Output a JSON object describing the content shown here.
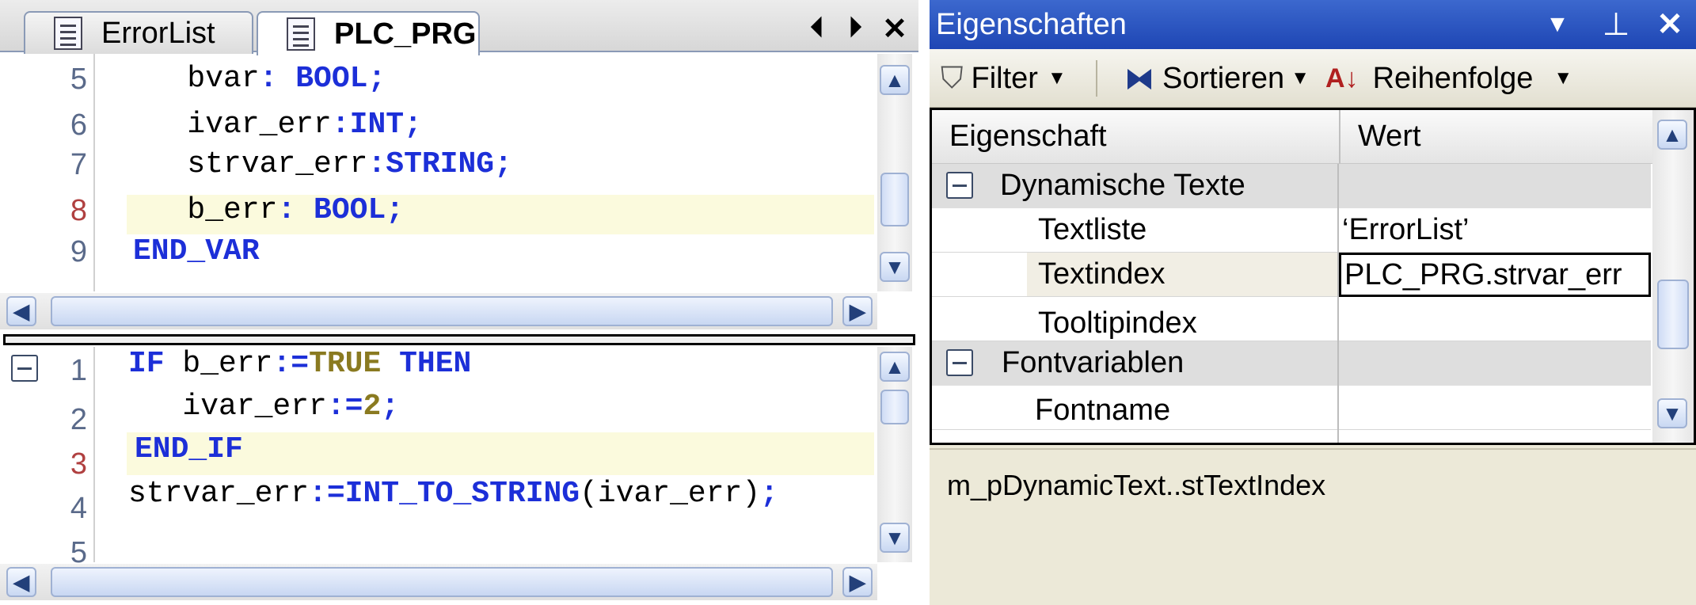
{
  "editor": {
    "tabs": [
      {
        "label": "ErrorList",
        "active": false
      },
      {
        "label": "PLC_PRG",
        "active": true
      }
    ],
    "tab_controls": {
      "prev": "⏴",
      "next": "⏵",
      "close": "✕"
    },
    "declaration_lines": [
      {
        "num": "5",
        "indent": "   ",
        "tokens": [
          {
            "t": "bvar",
            "c": "id"
          },
          {
            "t": ": BOOL;",
            "c": "kw"
          }
        ]
      },
      {
        "num": "6",
        "indent": "   ",
        "tokens": [
          {
            "t": "ivar_err",
            "c": "id"
          },
          {
            "t": ":INT;",
            "c": "kw"
          }
        ]
      },
      {
        "num": "7",
        "indent": "   ",
        "tokens": [
          {
            "t": "strvar_err",
            "c": "id"
          },
          {
            "t": ":STRING;",
            "c": "kw"
          }
        ]
      },
      {
        "num": "8",
        "indent": "   ",
        "tokens": [
          {
            "t": "b_err",
            "c": "id"
          },
          {
            "t": ": BOOL;",
            "c": "kw"
          }
        ]
      },
      {
        "num": "9",
        "indent": "",
        "tokens": [
          {
            "t": "END_VAR",
            "c": "kw"
          }
        ]
      }
    ],
    "implementation_lines": [
      {
        "num": "1",
        "tokens": [
          {
            "t": "IF ",
            "c": "kw"
          },
          {
            "t": "b_err",
            "c": "id"
          },
          {
            "t": ":=",
            "c": "kw"
          },
          {
            "t": "TRUE",
            "c": "lit"
          },
          {
            "t": " THEN",
            "c": "kw"
          }
        ]
      },
      {
        "num": "2",
        "tokens": [
          {
            "t": "   ivar_err",
            "c": "id"
          },
          {
            "t": ":=",
            "c": "kw"
          },
          {
            "t": "2",
            "c": "lit"
          },
          {
            "t": ";",
            "c": "kw"
          }
        ]
      },
      {
        "num": "3",
        "tokens": [
          {
            "t": "END_IF",
            "c": "kw"
          }
        ]
      },
      {
        "num": "4",
        "tokens": [
          {
            "t": "strvar_err",
            "c": "id"
          },
          {
            "t": ":=INT_TO_STRING",
            "c": "kw"
          },
          {
            "t": "(ivar_err)",
            "c": "id"
          },
          {
            "t": ";",
            "c": "kw"
          }
        ]
      },
      {
        "num": "5",
        "tokens": []
      }
    ]
  },
  "properties": {
    "title": "Eigenschaften",
    "toolbar": {
      "filter_label": "Filter",
      "sort_label": "Sortieren",
      "order_label": "Reihenfolge"
    },
    "grid": {
      "col_property": "Eigenschaft",
      "col_value": "Wert",
      "categories": [
        {
          "name": "Dynamische Texte",
          "rows": [
            {
              "name": "Textliste",
              "value": "‘ErrorList’"
            },
            {
              "name": "Textindex",
              "value": "PLC_PRG.strvar_err"
            },
            {
              "name": "Tooltipindex",
              "value": ""
            }
          ]
        },
        {
          "name": "Fontvariablen",
          "rows": [
            {
              "name": "Fontname",
              "value": ""
            }
          ]
        }
      ]
    },
    "description": "m_pDynamicText..stTextIndex"
  },
  "colors": {
    "keyword": "#1c2fd8",
    "literal": "#8a7a20",
    "title_bar": "#2850be",
    "highlight": "#fbfadd"
  }
}
